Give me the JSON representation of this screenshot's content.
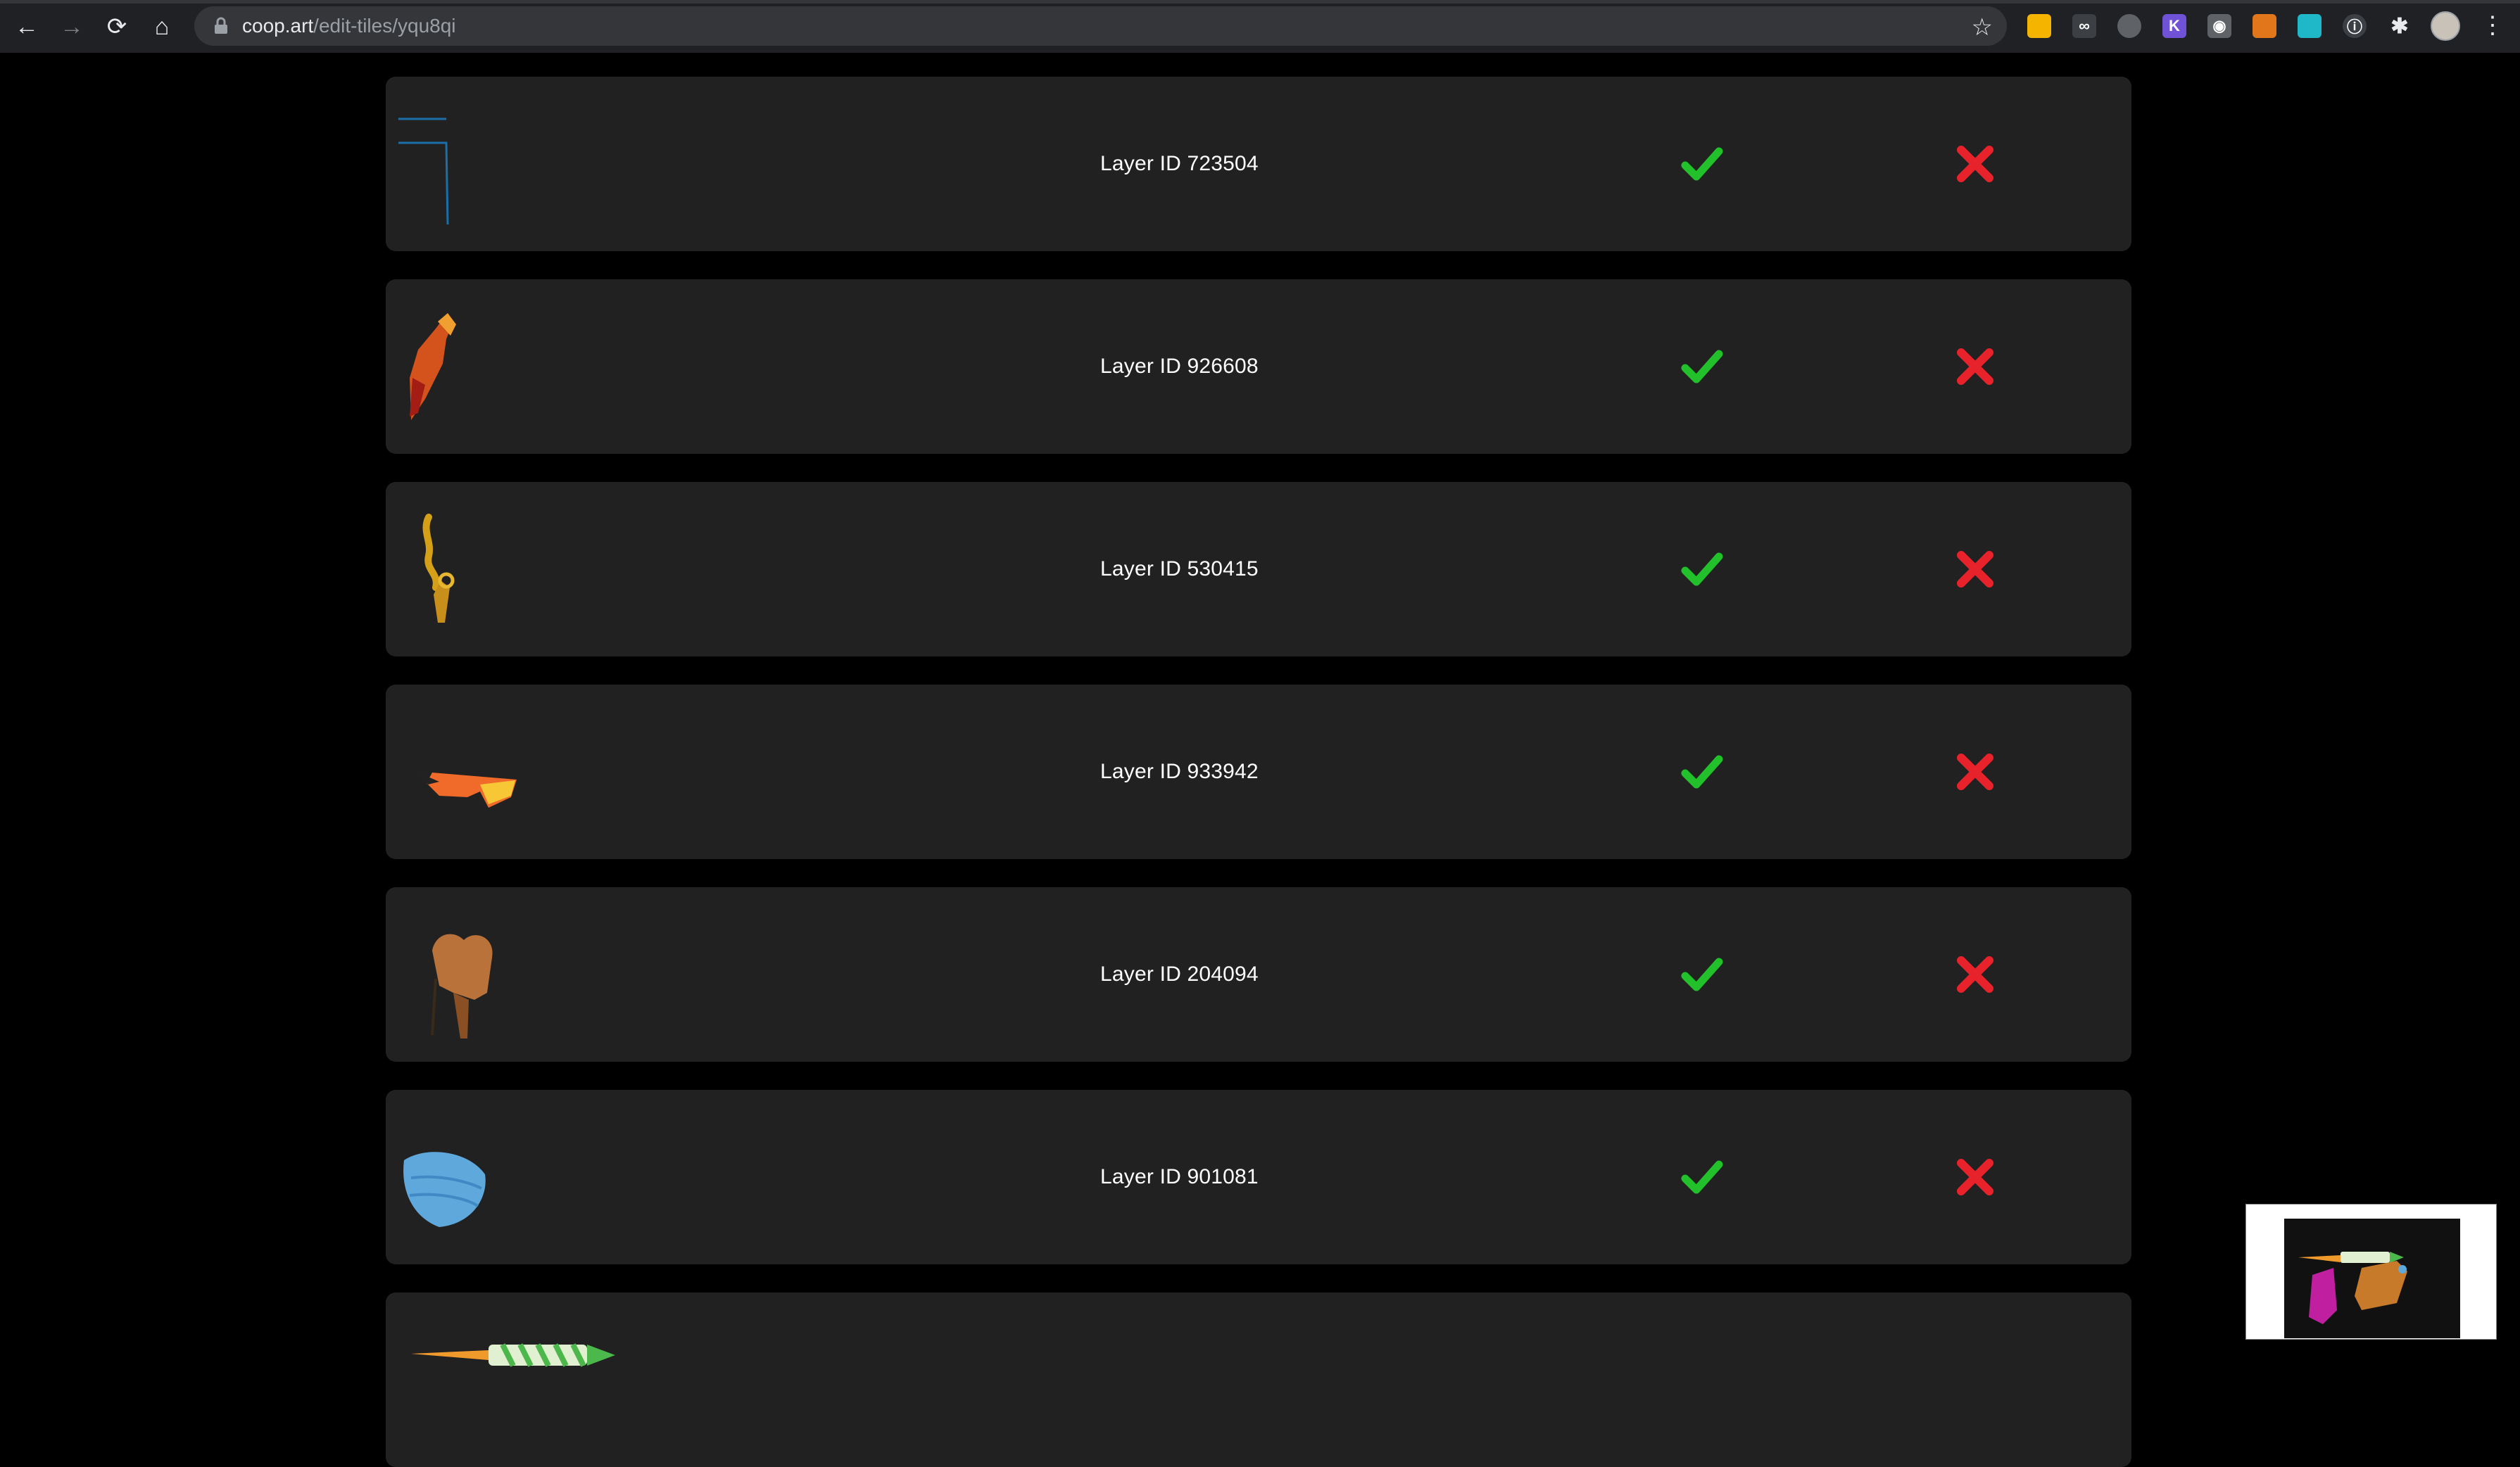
{
  "browser": {
    "url_host": "coop.art",
    "url_path": "/edit-tiles/yqu8qi"
  },
  "rows": [
    {
      "label": "Layer ID 723504",
      "thumb": "blue-lines-icon"
    },
    {
      "label": "Layer ID 926608",
      "thumb": "fire-horse-icon"
    },
    {
      "label": "Layer ID 530415",
      "thumb": "gold-chain-icon"
    },
    {
      "label": "Layer ID 933942",
      "thumb": "sunglasses-icon"
    },
    {
      "label": "Layer ID 204094",
      "thumb": "saddle-icon"
    },
    {
      "label": "Layer ID 901081",
      "thumb": "face-mask-icon"
    },
    {
      "label": "",
      "thumb": "firework-rocket-icon"
    }
  ],
  "colors": {
    "approve": "#22c02a",
    "reject": "#e8222a",
    "row_bg": "#212121"
  }
}
